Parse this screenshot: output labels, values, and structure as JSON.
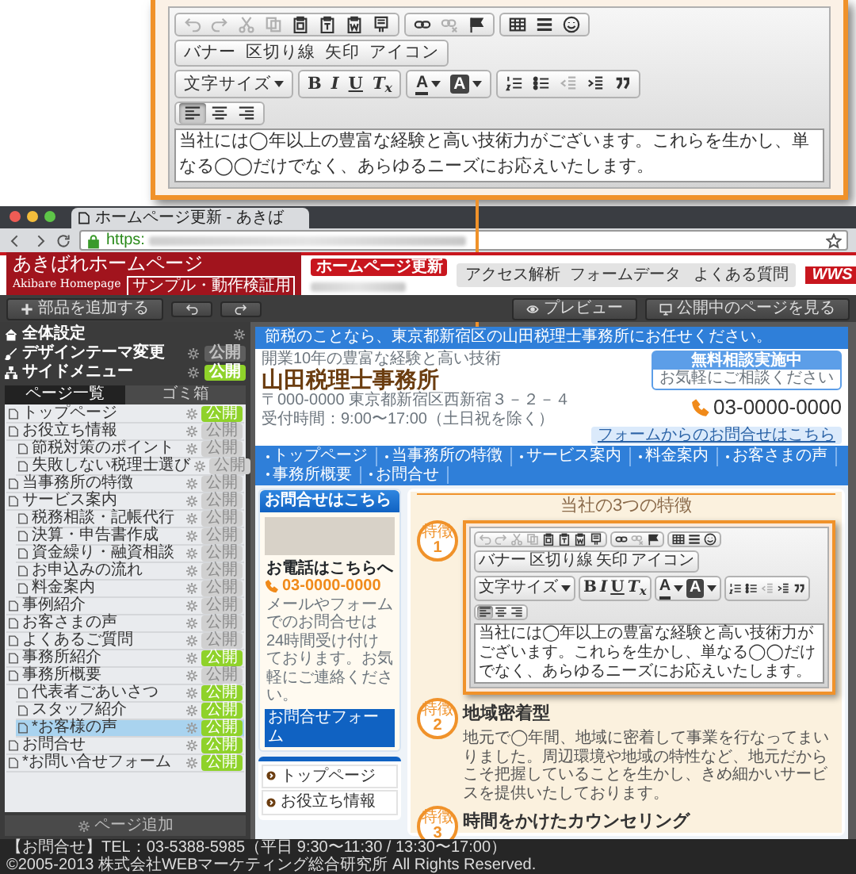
{
  "callout": {
    "toolbar": [
      [
        [
          {
            "kind": "undo",
            "disabled": true
          },
          {
            "kind": "redo",
            "disabled": true
          },
          {
            "kind": "cut",
            "disabled": true
          },
          {
            "kind": "copy",
            "disabled": true
          },
          {
            "kind": "paste",
            "disabled": false
          },
          {
            "kind": "paste-text",
            "disabled": false
          },
          {
            "kind": "paste-word",
            "disabled": false
          },
          {
            "kind": "template",
            "disabled": false
          }
        ],
        [
          {
            "kind": "link",
            "disabled": false
          },
          {
            "kind": "unlink",
            "disabled": true
          },
          {
            "kind": "anchor",
            "disabled": false
          }
        ],
        [
          {
            "kind": "table",
            "disabled": false
          },
          {
            "kind": "hr",
            "disabled": false
          },
          {
            "kind": "smiley",
            "disabled": false
          }
        ]
      ],
      [
        [
          {
            "kind": "text",
            "label": "バナー"
          },
          {
            "kind": "text",
            "label": "区切り線"
          },
          {
            "kind": "text",
            "label": "矢印"
          },
          {
            "kind": "text",
            "label": "アイコン"
          }
        ]
      ],
      [
        [
          {
            "kind": "dropdown",
            "label": "文字サイズ"
          }
        ],
        [
          {
            "kind": "bold",
            "label": "B"
          },
          {
            "kind": "italic",
            "label": "I"
          },
          {
            "kind": "underline",
            "label": "U"
          },
          {
            "kind": "clear-format",
            "label": "T$_{x}$"
          }
        ],
        [
          {
            "kind": "text-color",
            "label": "A"
          },
          {
            "kind": "bg-color",
            "label": "A"
          }
        ],
        [
          {
            "kind": "ol",
            "disabled": false
          },
          {
            "kind": "ul",
            "disabled": false
          },
          {
            "kind": "outdent",
            "disabled": true
          },
          {
            "kind": "indent",
            "disabled": false
          },
          {
            "kind": "quote",
            "disabled": false
          }
        ]
      ],
      [
        [
          {
            "kind": "align-left",
            "selected": true
          },
          {
            "kind": "align-center",
            "selected": false
          },
          {
            "kind": "align-right",
            "selected": false
          }
        ]
      ]
    ],
    "text": "当社には◯年以上の豊富な経験と高い技術力がございます。これらを生かし、単なる◯◯だけでなく、あらゆるニーズにお応えいたします。"
  },
  "browser": {
    "tab_title": "ホームページ更新 - あきば",
    "address": "https:"
  },
  "app_header": {
    "logo_title": "あきばれホームページ",
    "logo_subtitle": "Akibare Homepage",
    "logo_tag": "サンプル・動作検証用",
    "badge": "ホームページ更新",
    "links": [
      {
        "label": "アクセス解析",
        "kind": "text"
      },
      {
        "label": "フォームデータ",
        "kind": "text"
      },
      {
        "label": "よくある質問",
        "kind": "help"
      }
    ],
    "brand_logo": "WWS"
  },
  "app_toolbar": {
    "add_button": "部品を追加する",
    "preview_button": "プレビュー",
    "view_button": "公開中のページを見る"
  },
  "sidebar": {
    "settings": [
      {
        "label": "全体設定",
        "kind": "settings"
      },
      {
        "label": "デザインテーマ変更",
        "kind": "theme",
        "badge": "公開",
        "published": false
      },
      {
        "label": "サイドメニュー",
        "kind": "menu",
        "badge": "公開",
        "published": true
      }
    ],
    "tabs": [
      {
        "label": "ページ一覧",
        "selected": true
      },
      {
        "label": "ゴミ箱",
        "selected": false
      }
    ],
    "pages": [
      {
        "label": "トップページ",
        "badge": "公開",
        "published": true,
        "selected": false
      },
      {
        "label": "お役立ち情報",
        "badge": "公開",
        "published": false,
        "selected": false,
        "children": [
          {
            "label": "節税対策のポイント",
            "badge": "公開",
            "published": false,
            "selected": false
          },
          {
            "label": "失敗しない税理士選び",
            "badge": "公開",
            "published": false,
            "selected": false
          }
        ]
      },
      {
        "label": "当事務所の特徴",
        "badge": "公開",
        "published": false,
        "selected": false
      },
      {
        "label": "サービス案内",
        "badge": "公開",
        "published": false,
        "selected": false,
        "children": [
          {
            "label": "税務相談・記帳代行",
            "badge": "公開",
            "published": false,
            "selected": false
          },
          {
            "label": "決算・申告書作成",
            "badge": "公開",
            "published": false,
            "selected": false
          },
          {
            "label": "資金繰り・融資相談",
            "badge": "公開",
            "published": false,
            "selected": false
          },
          {
            "label": "お申込みの流れ",
            "badge": "公開",
            "published": false,
            "selected": false
          },
          {
            "label": "料金案内",
            "badge": "公開",
            "published": false,
            "selected": false
          }
        ]
      },
      {
        "label": "事例紹介",
        "badge": "公開",
        "published": false,
        "selected": false
      },
      {
        "label": "お客さまの声",
        "badge": "公開",
        "published": false,
        "selected": false
      },
      {
        "label": "よくあるご質問",
        "badge": "公開",
        "published": false,
        "selected": false
      },
      {
        "label": "事務所紹介",
        "badge": "公開",
        "published": true,
        "selected": false
      },
      {
        "label": "事務所概要",
        "badge": "公開",
        "published": false,
        "selected": false,
        "children": [
          {
            "label": "代表者ごあいさつ",
            "badge": "公開",
            "published": true,
            "selected": false
          },
          {
            "label": "スタッフ紹介",
            "badge": "公開",
            "published": true,
            "selected": false
          },
          {
            "label": "*お客様の声",
            "badge": "公開",
            "published": true,
            "selected": true
          }
        ]
      },
      {
        "label": "お問合せ",
        "badge": "公開",
        "published": true,
        "selected": false
      },
      {
        "label": "*お問い合せフォーム",
        "badge": "公開",
        "published": true,
        "selected": false
      }
    ],
    "add_page": "ページ追加"
  },
  "site": {
    "top_bar": "節税のことなら、東京都新宿区の山田税理士事務所にお任せください。",
    "tagline": "開業10年の豊富な経験と高い技術",
    "name": "山田税理士事務所",
    "address": "〒000-0000 東京都新宿区西新宿３－２－４",
    "hours": "受付時間：9:00〜17:00（土日祝を除く）",
    "consult_title": "無料相談実施中",
    "consult_text": "お気軽にご相談ください",
    "phone": "03-0000-0000",
    "form_link": "フォームからのお問合せはこちら",
    "nav": [
      "トップページ",
      "当事務所の特徴",
      "サービス案内",
      "料金案内",
      "お客さまの声",
      "事務所概要",
      "お問合せ"
    ],
    "contact_box": {
      "title": "お問合せはこちら",
      "phone_label": "お電話はこちらへ",
      "phone": "03-0000-0000",
      "text": "メールやフォームでのお問合せは24時間受け付けております。お気軽にご連絡ください。",
      "button": "お問合せフォーム"
    },
    "side_menu": [
      "トップページ",
      "お役立ち情報"
    ],
    "section_title": "当社の3つの特徴",
    "features": [
      {
        "kind": "editor",
        "badge_label": "特徴",
        "number": "1",
        "toolbar": [
          [
            [
              {
                "kind": "undo",
                "disabled": true
              },
              {
                "kind": "redo",
                "disabled": true
              },
              {
                "kind": "cut",
                "disabled": true
              },
              {
                "kind": "copy",
                "disabled": true
              },
              {
                "kind": "paste",
                "disabled": false
              },
              {
                "kind": "paste-text",
                "disabled": false
              },
              {
                "kind": "paste-word",
                "disabled": false
              },
              {
                "kind": "template",
                "disabled": false
              }
            ],
            [
              {
                "kind": "link",
                "disabled": false
              },
              {
                "kind": "unlink",
                "disabled": true
              },
              {
                "kind": "anchor",
                "disabled": false
              }
            ],
            [
              {
                "kind": "table",
                "disabled": false
              },
              {
                "kind": "hr",
                "disabled": false
              },
              {
                "kind": "smiley",
                "disabled": false
              }
            ]
          ],
          [
            [
              {
                "kind": "text",
                "label": "バナー"
              },
              {
                "kind": "text",
                "label": "区切り線"
              },
              {
                "kind": "text",
                "label": "矢印"
              },
              {
                "kind": "text",
                "label": "アイコン"
              }
            ]
          ],
          [
            [
              {
                "kind": "dropdown",
                "label": "文字サイズ"
              }
            ],
            [
              {
                "kind": "bold",
                "label": "B"
              },
              {
                "kind": "italic",
                "label": "I"
              },
              {
                "kind": "underline",
                "label": "U"
              },
              {
                "kind": "clear-format",
                "label": "T$_{x}$"
              }
            ],
            [
              {
                "kind": "text-color",
                "label": "A"
              },
              {
                "kind": "bg-color",
                "label": "A"
              }
            ],
            [
              {
                "kind": "ol",
                "disabled": false
              },
              {
                "kind": "ul",
                "disabled": false
              },
              {
                "kind": "outdent",
                "disabled": true
              },
              {
                "kind": "indent",
                "disabled": false
              },
              {
                "kind": "quote",
                "disabled": false
              }
            ]
          ],
          [
            [
              {
                "kind": "align-left",
                "selected": true
              },
              {
                "kind": "align-center",
                "selected": false
              },
              {
                "kind": "align-right",
                "selected": false
              }
            ]
          ]
        ],
        "text": "当社には◯年以上の豊富な経験と高い技術力がございます。これらを生かし、単なる◯◯だけでなく、あらゆるニーズにお応えいたします。"
      },
      {
        "kind": "text",
        "badge_label": "特徴",
        "number": "2",
        "title": "地域密着型",
        "text": "地元で◯年間、地域に密着して事業を行なってまいりました。周辺環境や地域の特性など、地元だからこそ把握していることを生かし、きめ細かいサービスを提供いたしております。"
      },
      {
        "kind": "text",
        "badge_label": "特徴",
        "number": "3",
        "title": "時間をかけたカウンセリング"
      }
    ]
  },
  "footer": {
    "contact": "【お問合せ】TEL：03-5388-5985（平日 9:30〜11:30 / 13:30〜17:00）",
    "copyright": "©2005-2013 株式会社WEBマーケティング総合研究所 All Rights Reserved."
  }
}
